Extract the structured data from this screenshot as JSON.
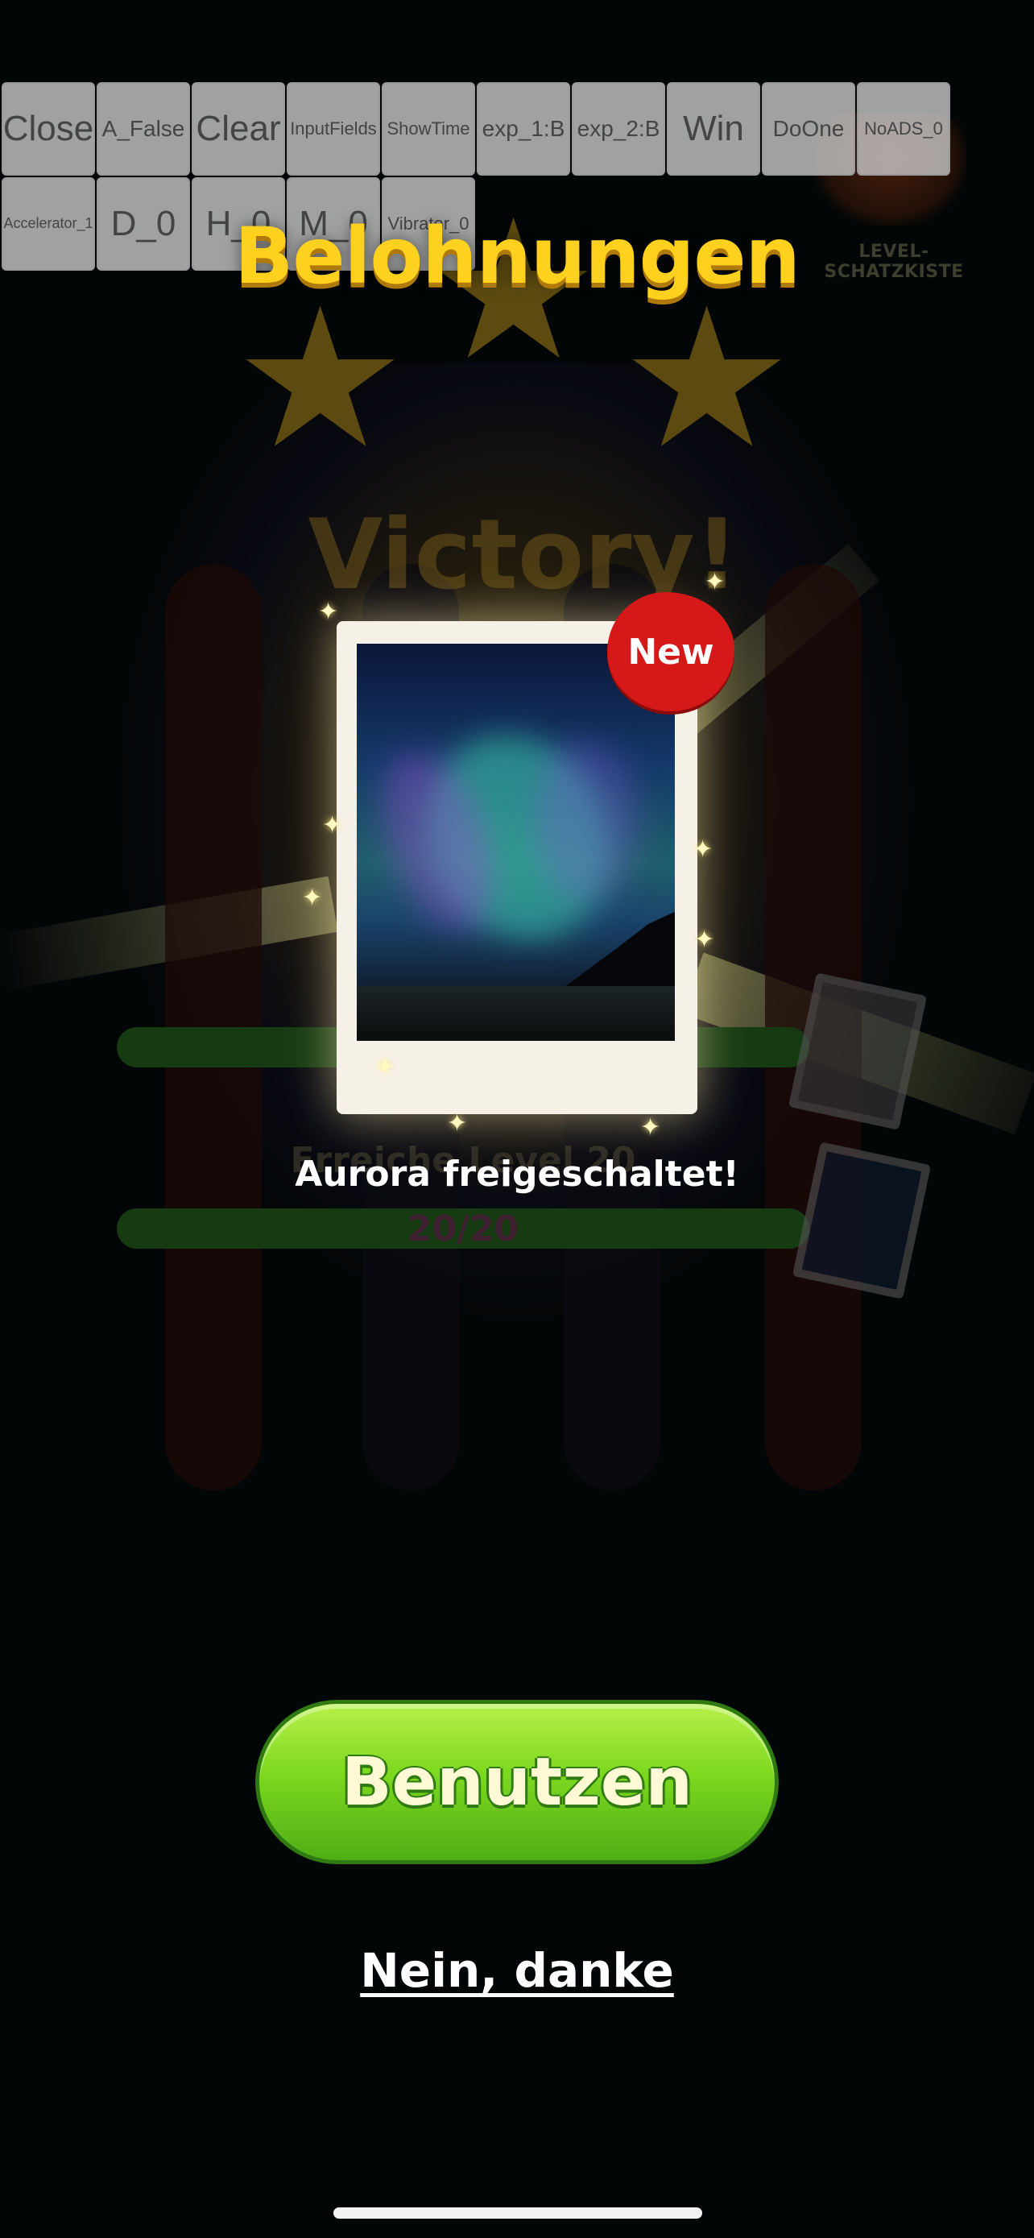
{
  "debug_buttons": [
    {
      "label": "Close",
      "size": "big"
    },
    {
      "label": "A_False",
      "size": "mid"
    },
    {
      "label": "Clear",
      "size": "big"
    },
    {
      "label": "InputFields",
      "size": "small"
    },
    {
      "label": "ShowTime",
      "size": "small"
    },
    {
      "label": "exp_1:B",
      "size": "mid"
    },
    {
      "label": "exp_2:B",
      "size": "mid"
    },
    {
      "label": "Win",
      "size": "big"
    },
    {
      "label": "DoOne",
      "size": "mid"
    },
    {
      "label": "NoADS_0",
      "size": "small"
    },
    {
      "label": "Accelerator_1",
      "size": "tiny"
    },
    {
      "label": "D_0",
      "size": "big"
    },
    {
      "label": "H_0",
      "size": "big"
    },
    {
      "label": "M_0",
      "size": "big"
    },
    {
      "label": "Vibrator_0",
      "size": "small"
    }
  ],
  "background": {
    "chest_label": "LEVEL-SCHATZKISTE",
    "victory_text": "Victory!",
    "goal_text": "Erreiche Level 20",
    "progress_text": "20/20"
  },
  "rewards": {
    "title": "Belohnungen",
    "badge_new": "New",
    "unlock_text": "Aurora freigeschaltet!",
    "use_button": "Benutzen",
    "decline_button": "Nein, danke"
  },
  "colors": {
    "title": "#ffd11f",
    "use_button": "#7dd81f",
    "badge": "#d51919"
  }
}
